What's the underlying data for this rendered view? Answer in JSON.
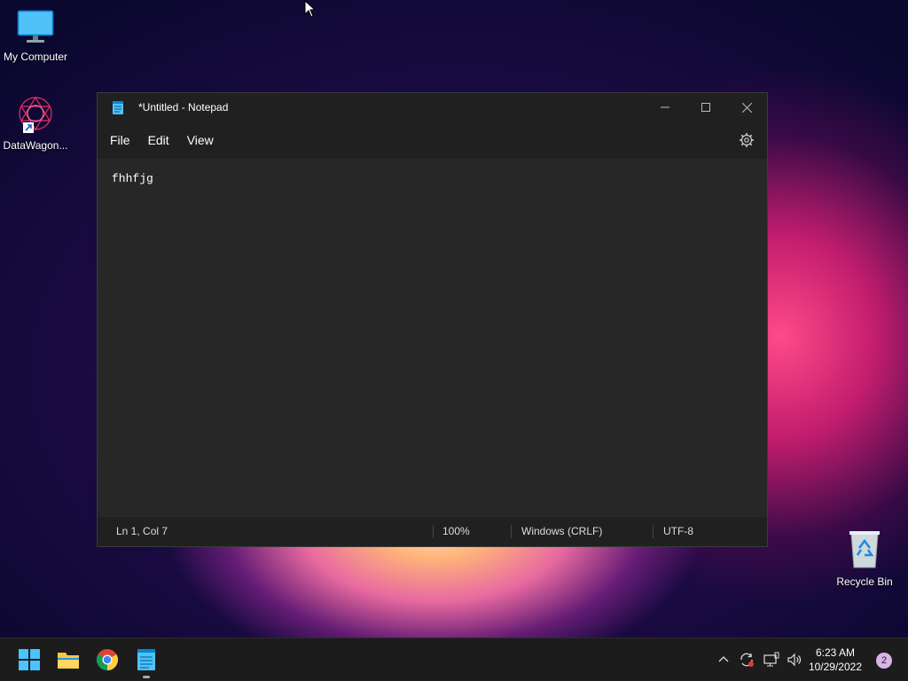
{
  "desktop": {
    "icons": [
      {
        "label": "My Computer"
      },
      {
        "label": "DataWagon..."
      },
      {
        "label": "Recycle Bin"
      }
    ]
  },
  "notepad": {
    "title": "*Untitled - Notepad",
    "menu": [
      "File",
      "Edit",
      "View"
    ],
    "content": "fhhfjg",
    "status": {
      "position": "Ln 1, Col 7",
      "zoom": "100%",
      "line_ending": "Windows (CRLF)",
      "encoding": "UTF-8"
    }
  },
  "taskbar": {
    "time": "6:23 AM",
    "date": "10/29/2022",
    "notifications": "2"
  },
  "colors": {
    "accent": "#0078d4",
    "window_bg": "#202020",
    "editor_bg": "#272727",
    "taskbar_bg": "#1c1c1c"
  }
}
